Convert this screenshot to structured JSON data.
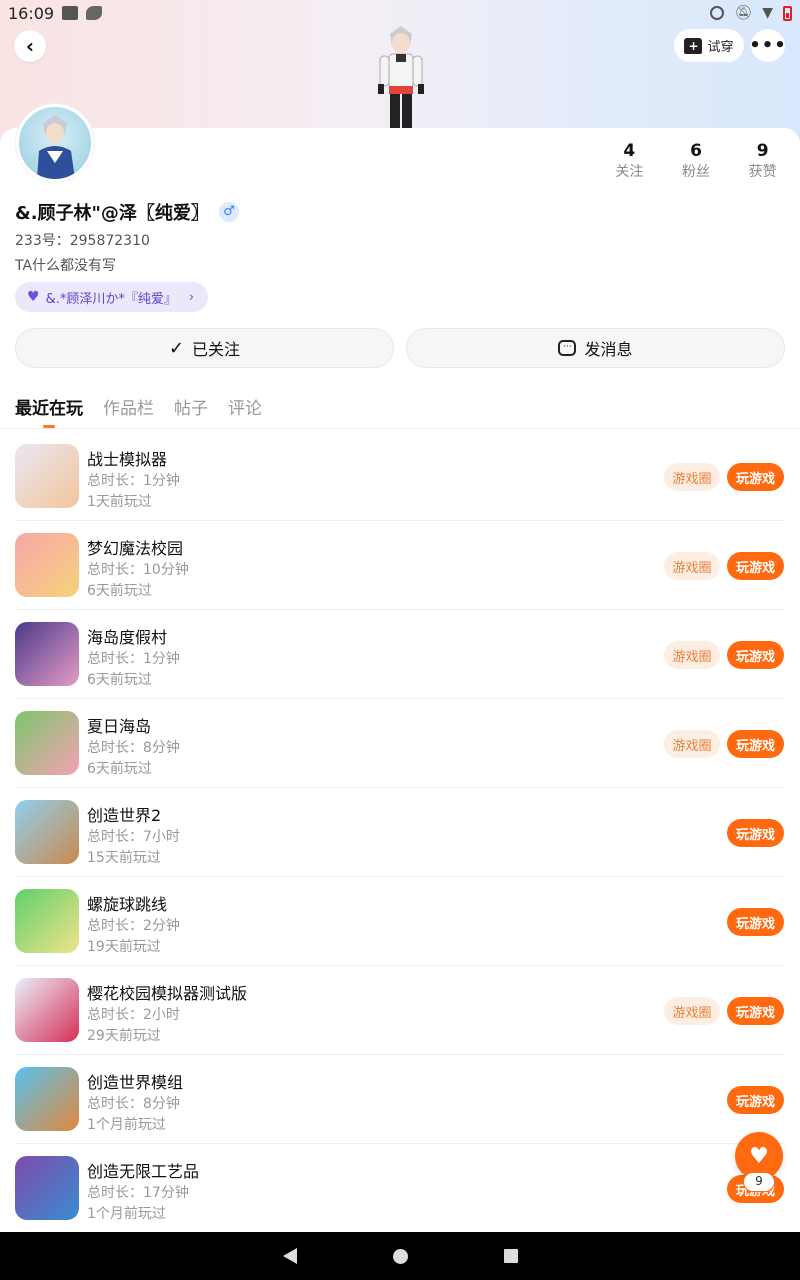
{
  "status_bar": {
    "time": "16:09"
  },
  "header": {
    "tryon_label": "试穿"
  },
  "profile": {
    "name": "&.顾子林\"@泽〖纯爱〗",
    "gender_symbol": "♂",
    "uid": "233号：295872310",
    "bio": "TA什么都没有写",
    "relation_tag": "&.*顾泽川か*『纯爱』",
    "stats": [
      {
        "num": "4",
        "label": "关注"
      },
      {
        "num": "6",
        "label": "粉丝"
      },
      {
        "num": "9",
        "label": "获赞"
      }
    ]
  },
  "actions": {
    "follow_label": "已关注",
    "message_label": "发消息"
  },
  "tabs": [
    "最近在玩",
    "作品栏",
    "帖子",
    "评论"
  ],
  "game_buttons": {
    "circle": "游戏圈",
    "play": "玩游戏"
  },
  "games": [
    {
      "title": "战士模拟器",
      "duration": "总时长：1分钟",
      "last_played": "1天前玩过",
      "has_circle": true,
      "colors": [
        "#e9e7f5",
        "#f3c59a"
      ]
    },
    {
      "title": "梦幻魔法校园",
      "duration": "总时长：10分钟",
      "last_played": "6天前玩过",
      "has_circle": true,
      "colors": [
        "#f7a7a9",
        "#f6d27a"
      ]
    },
    {
      "title": "海岛度假村",
      "duration": "总时长：1分钟",
      "last_played": "6天前玩过",
      "has_circle": true,
      "colors": [
        "#4a3a8c",
        "#e69bc4"
      ]
    },
    {
      "title": "夏日海岛",
      "duration": "总时长：8分钟",
      "last_played": "6天前玩过",
      "has_circle": true,
      "colors": [
        "#7cc56b",
        "#f5a2b4"
      ]
    },
    {
      "title": "创造世界2",
      "duration": "总时长：7小时",
      "last_played": "15天前玩过",
      "has_circle": false,
      "colors": [
        "#8fd0f2",
        "#c98a4a"
      ]
    },
    {
      "title": "螺旋球跳线",
      "duration": "总时长：2分钟",
      "last_played": "19天前玩过",
      "has_circle": false,
      "colors": [
        "#5fd16a",
        "#f1e28b"
      ]
    },
    {
      "title": "樱花校园模拟器测试版",
      "duration": "总时长：2小时",
      "last_played": "29天前玩过",
      "has_circle": true,
      "colors": [
        "#e9f0fb",
        "#d62f55"
      ]
    },
    {
      "title": "创造世界模组",
      "duration": "总时长：8分钟",
      "last_played": "1个月前玩过",
      "has_circle": false,
      "colors": [
        "#58c2ef",
        "#e2883c"
      ]
    },
    {
      "title": "创造无限工艺品",
      "duration": "总时长：17分钟",
      "last_played": "1个月前玩过",
      "has_circle": false,
      "colors": [
        "#7d4ca8",
        "#3b8bd4"
      ]
    }
  ],
  "fab": {
    "badge": "9"
  }
}
